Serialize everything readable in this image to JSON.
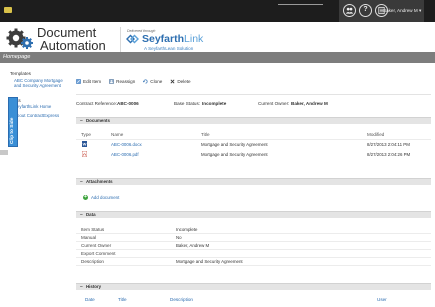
{
  "topbar": {
    "icons": [
      "people-icon",
      "help-icon",
      "settings-icon"
    ],
    "help_glyph": "?",
    "user_menu": "Baker, Andrew M ▾"
  },
  "header": {
    "app_title_line1": "Document",
    "app_title_line2": "Automation",
    "delivered_through": "Delivered through",
    "brand_part1": "Seyfarth",
    "brand_part2": "Link",
    "brand_sub": "A SeyfarthLean Solution"
  },
  "homebar": {
    "label": "Homepage"
  },
  "leftnav": {
    "templates_heading": "Templates",
    "templates": [
      "ABC Company Mortgage and Security Agreement"
    ],
    "links_heading": "Links",
    "links": [
      "SeyfarthLink Home",
      "About ContractExpress"
    ],
    "clip_tab": "Clip to Side"
  },
  "toolbar": {
    "edit": "Edit Item",
    "reassign": "Reassign",
    "clone": "Clone",
    "delete": "Delete"
  },
  "info": {
    "contract_ref_label": "Contract Reference:",
    "contract_ref_value": "ABC-0006",
    "base_status_label": "Base Status:",
    "base_status_value": "Incomplete",
    "current_owner_label": "Current Owner:",
    "current_owner_value": "Baker, Andrew M"
  },
  "documents": {
    "title": "Documents",
    "columns": [
      "Type",
      "Name",
      "Title",
      "Modified"
    ],
    "rows": [
      {
        "type": "word",
        "name": "ABC-0006.docx",
        "title": "Mortgage and Security Agreement",
        "modified": "8/27/2013 2:04:11 PM"
      },
      {
        "type": "pdf",
        "name": "ABC-0006.pdf",
        "title": "Mortgage and Security Agreement",
        "modified": "8/27/2013 2:04:26 PM"
      }
    ]
  },
  "attachments": {
    "title": "Attachments",
    "add_label": "Add document"
  },
  "data_section": {
    "title": "Data",
    "rows": [
      {
        "key": "Item Status",
        "value": "Incomplete"
      },
      {
        "key": "Manual",
        "value": "No"
      },
      {
        "key": "Current Owner",
        "value": "Baker, Andrew M"
      },
      {
        "key": "Export Comment",
        "value": ""
      },
      {
        "key": "Description",
        "value": "Mortgage and Security Agreement"
      }
    ]
  },
  "history": {
    "title": "History",
    "columns": [
      "Date",
      "Title",
      "Description",
      "User"
    ]
  },
  "colors": {
    "topbar": "#1d1d1d",
    "homebar": "#7d7d7d",
    "link": "#2b6cb0",
    "brand": "#2e6fb0",
    "clip_tab": "#3a8fd6",
    "section_bg": "#e4e4e4"
  }
}
